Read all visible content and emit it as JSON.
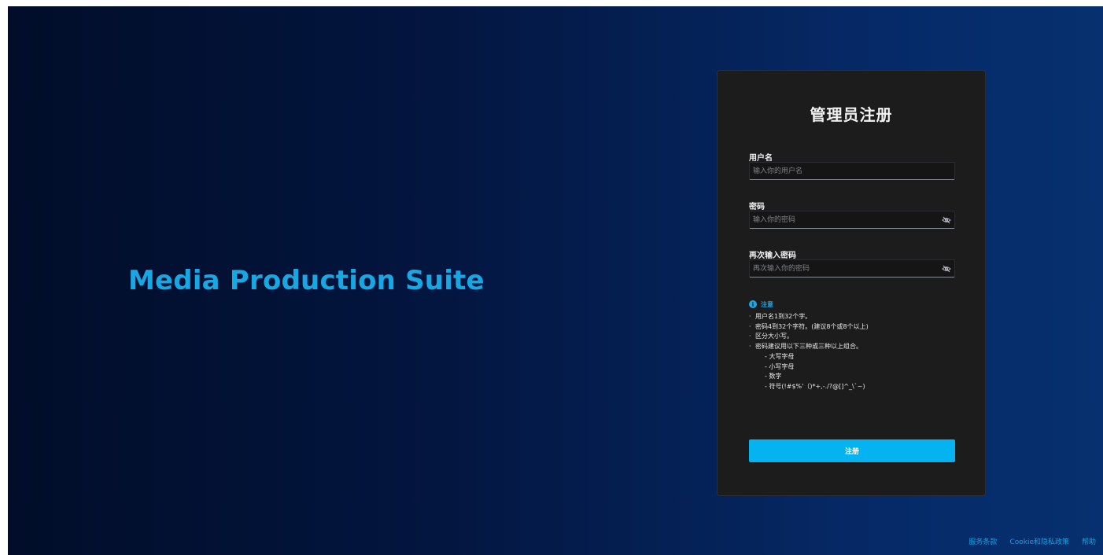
{
  "brand": {
    "title": "Media Production Suite",
    "color": "#17a7e3"
  },
  "form": {
    "title": "管理员注册",
    "username": {
      "label": "用户名",
      "placeholder": "输入你的用户名",
      "value": ""
    },
    "password": {
      "label": "密码",
      "placeholder": "输入你的密码",
      "value": "",
      "toggle_icon": "eye-off-icon"
    },
    "confirm_password": {
      "label": "再次输入密码",
      "placeholder": "再次输入你的密码",
      "value": "",
      "toggle_icon": "eye-off-icon"
    },
    "notice": {
      "icon": "info-icon",
      "title": "注意",
      "items": [
        "用户名1到32个字。",
        "密码4到32个字符。(建议8个或8个以上)",
        "区分大小写。",
        "密码建议用以下三种或三种以上组合。"
      ],
      "sub_items": [
        "大写字母",
        "小写字母",
        "数字",
        "符号(!#$%'（)*+,-./?@[]^_\\`~)"
      ]
    },
    "submit_label": "注册"
  },
  "footer": {
    "links": [
      "服务条款",
      "Cookie和隐私政策",
      "帮助"
    ]
  },
  "colors": {
    "accent": "#04b3ef",
    "card_bg": "#1c1c1d",
    "background_start": "#010d29",
    "background_end": "#06306f"
  }
}
